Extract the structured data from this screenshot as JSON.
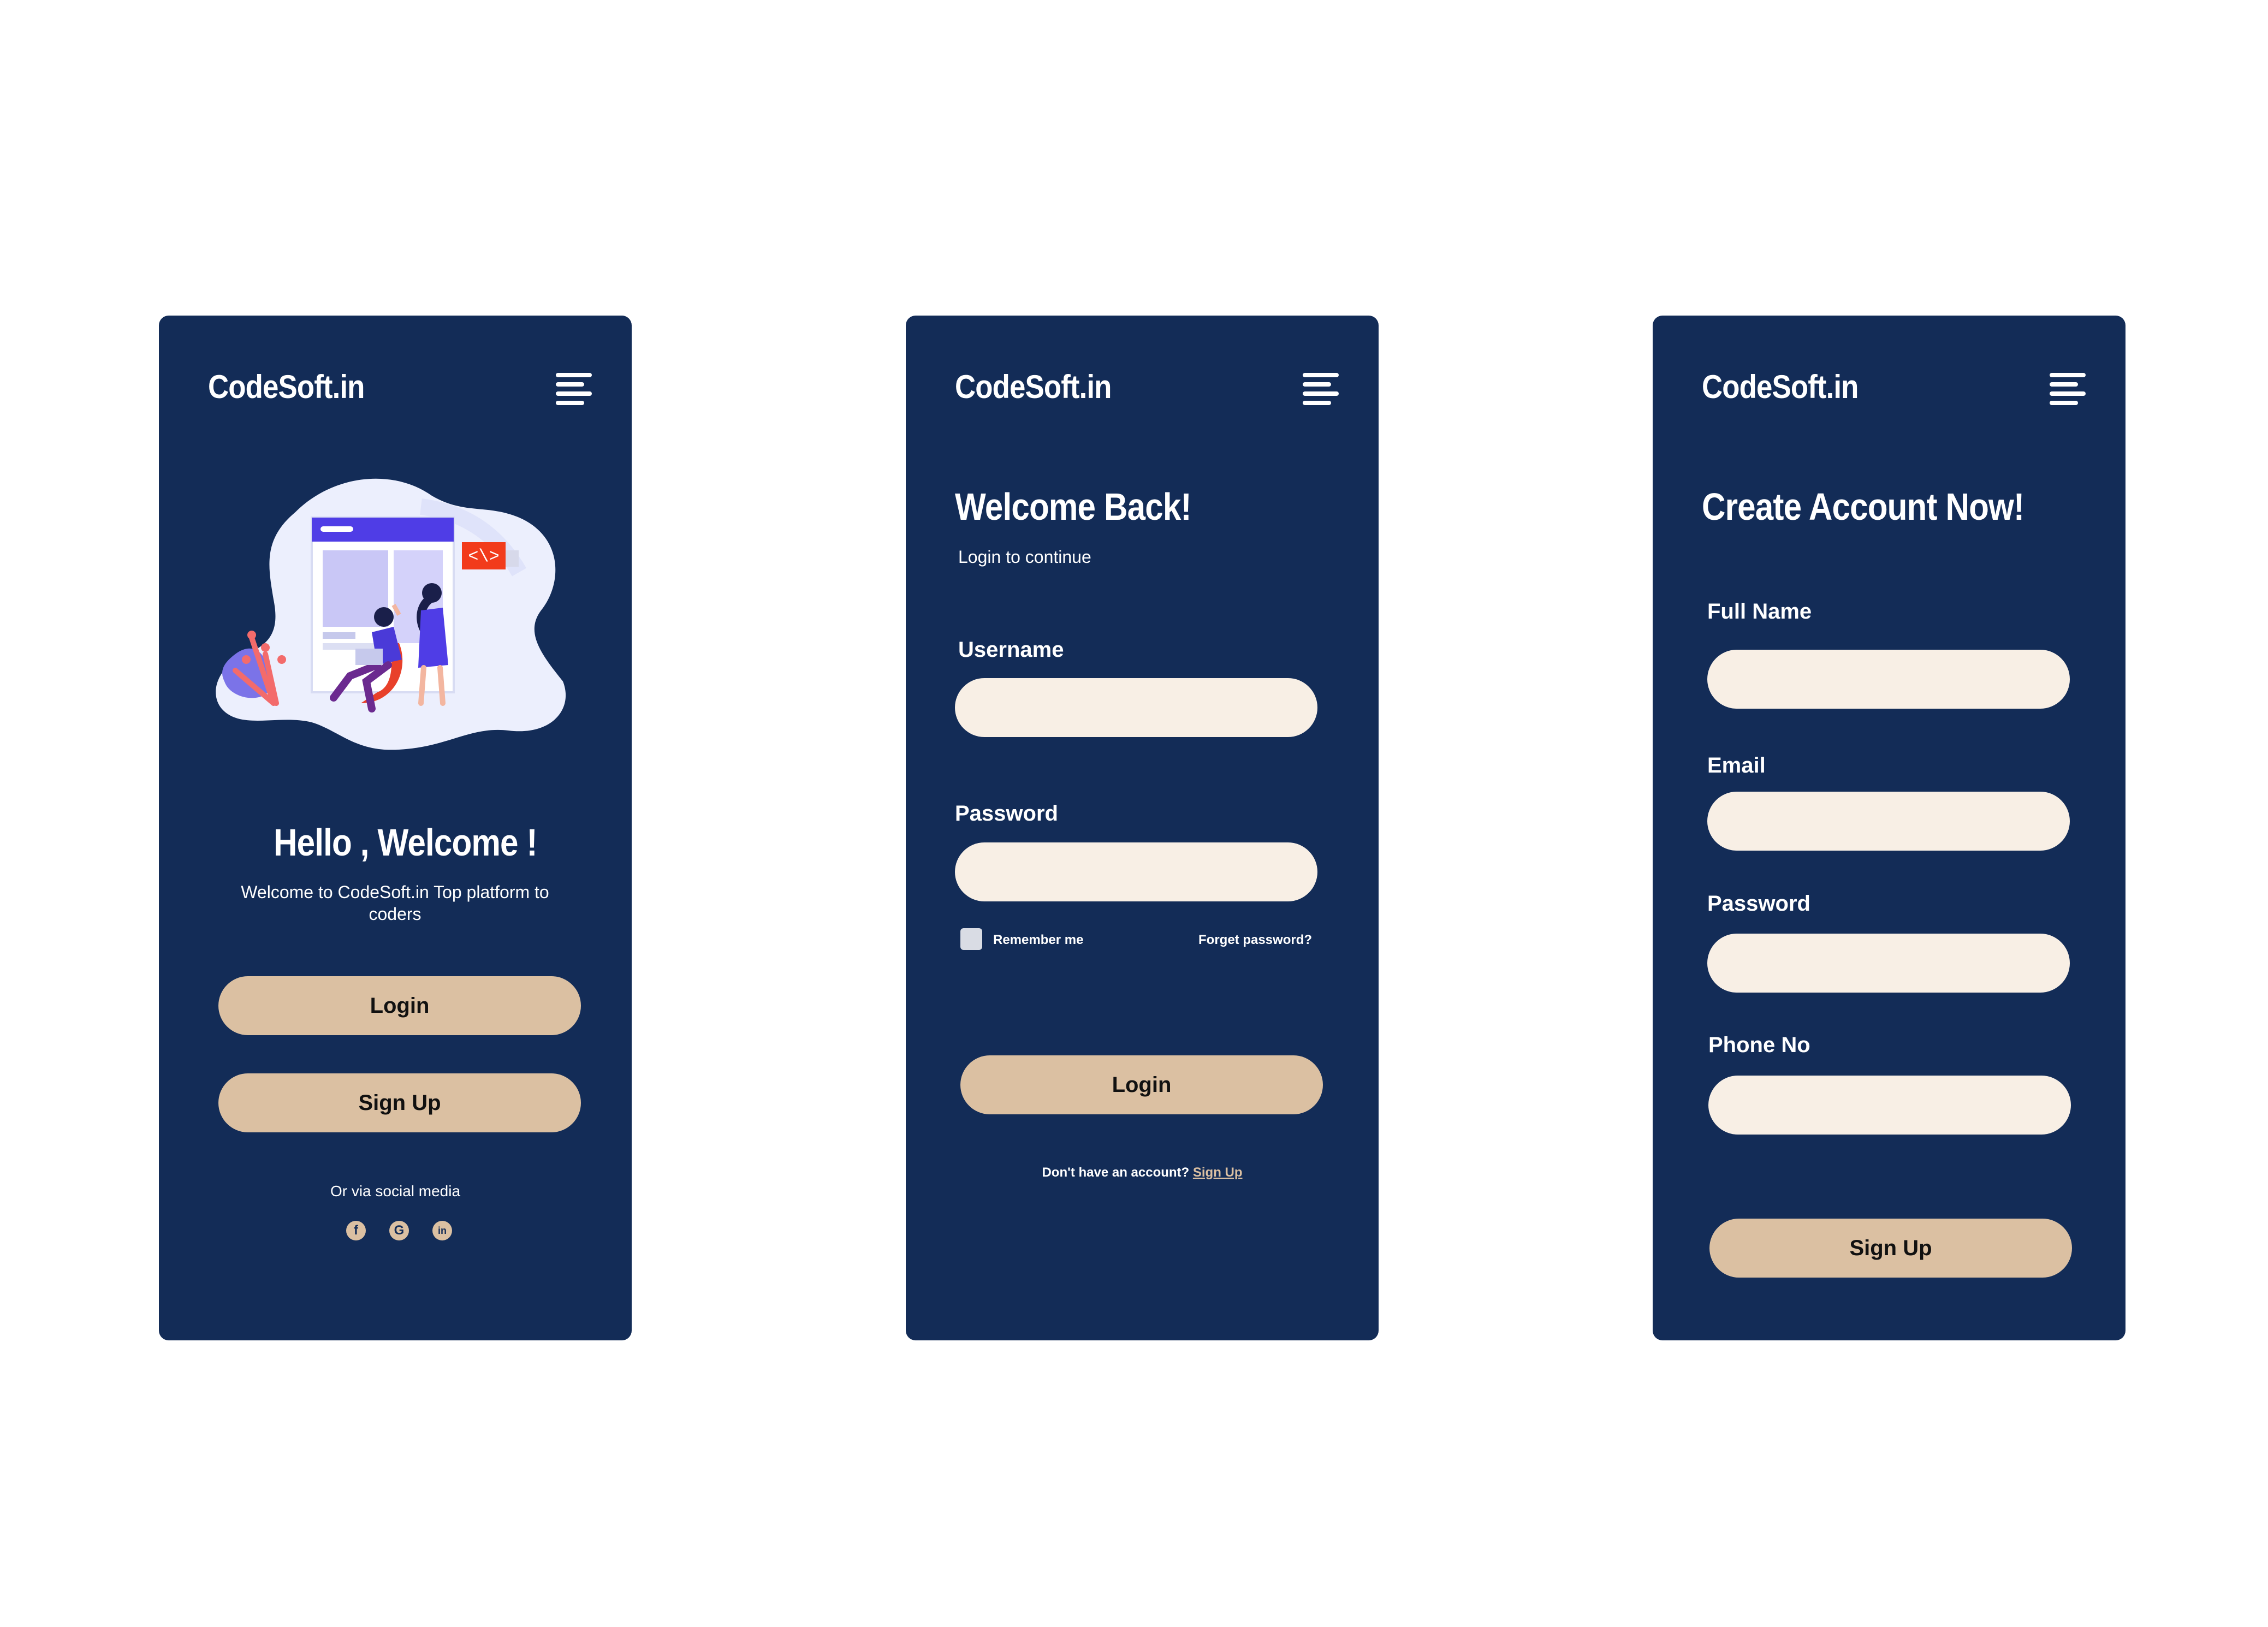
{
  "brand": "CodeSoft.in",
  "colors": {
    "panel": "#132c57",
    "accent": "#dbc0a2",
    "field": "#f8efe5",
    "text": "#ffffff"
  },
  "icons": {
    "menu": "hamburger-menu-icon",
    "facebook": "facebook-icon",
    "google": "google-icon",
    "linkedin": "linkedin-icon"
  },
  "welcome": {
    "title": "Hello , Welcome !",
    "subtitle": "Welcome to CodeSoft.in Top platform to coders",
    "login_label": "Login",
    "signup_label": "Sign Up",
    "social_text": "Or  via social media",
    "social": [
      "f",
      "G",
      "in"
    ],
    "illustration_tag": "<\\>"
  },
  "login": {
    "title": "Welcome Back!",
    "subtitle": "Login to continue",
    "username_label": "Username",
    "password_label": "Password",
    "remember_label": "Remember me",
    "forgot_label": "Forget password?",
    "login_label": "Login",
    "no_account_text": "Don't have an account?",
    "signup_link": "Sign Up"
  },
  "signup": {
    "title": "Create Account Now!",
    "fullname_label": "Full Name",
    "email_label": "Email",
    "password_label": "Password",
    "phone_label": "Phone No",
    "signup_label": "Sign Up"
  }
}
